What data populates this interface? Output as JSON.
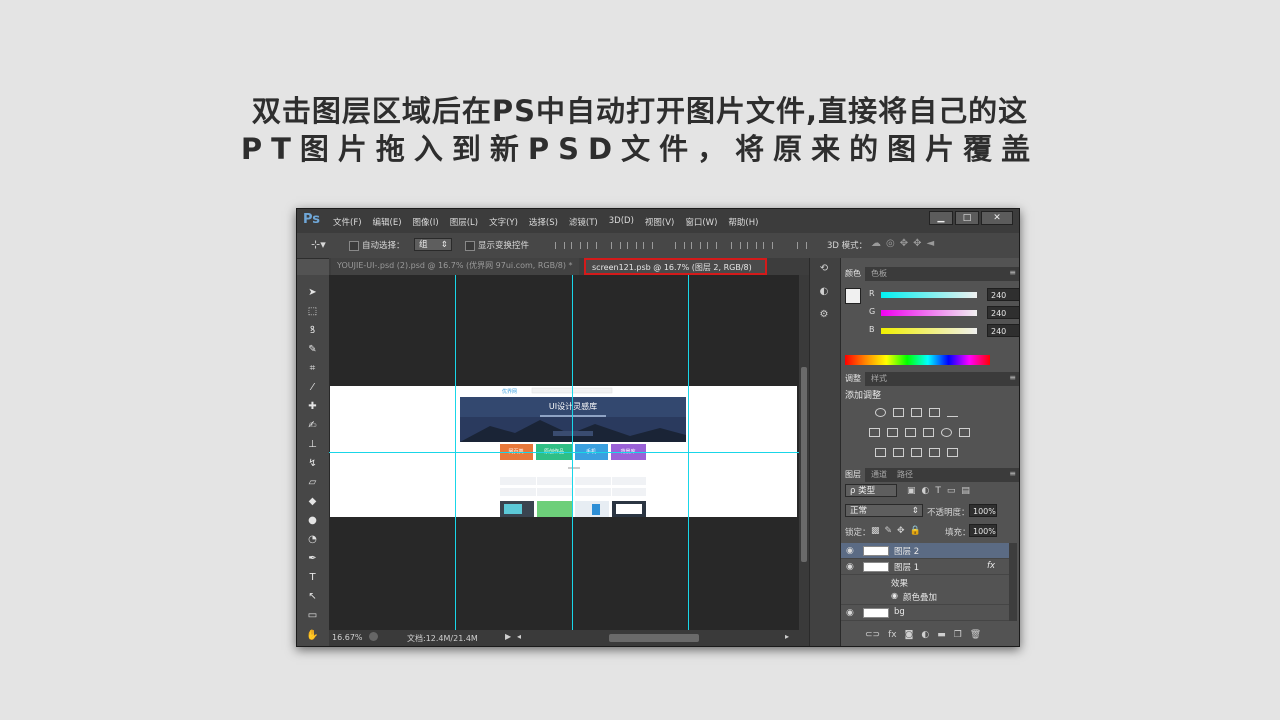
{
  "caption": {
    "line1": "双击图层区域后在PS中自动打开图片文件,直接将自己的这",
    "line2": "PT图片拖入到新PSD文件，将原来的图片覆盖"
  },
  "app": {
    "logo": "Ps",
    "menus": [
      "文件(F)",
      "编辑(E)",
      "图像(I)",
      "图层(L)",
      "文字(Y)",
      "选择(S)",
      "滤镜(T)",
      "3D(D)",
      "视图(V)",
      "窗口(W)",
      "帮助(H)"
    ],
    "window_buttons": [
      "▁",
      "□",
      "✕"
    ]
  },
  "options": {
    "auto_select_label": "自动选择：",
    "auto_select_value": "组",
    "show_transform_label": "显示变换控件",
    "mode_3d_label": "3D 模式："
  },
  "tabs": [
    {
      "label": "YOUJIE-UI-.psd (2).psd @ 16.7% (优界网 97ui.com, RGB/8) *",
      "close": "✕"
    },
    {
      "label": "screen121.psb @ 16.7% (图层 2, RGB/8)",
      "close": "✕"
    }
  ],
  "status": {
    "zoom": "16.67%",
    "doc_size": "文档:12.4M/21.4M"
  },
  "color_panel": {
    "tabs": [
      "颜色",
      "色板"
    ],
    "channels": [
      {
        "label": "R",
        "value": "240"
      },
      {
        "label": "G",
        "value": "240"
      },
      {
        "label": "B",
        "value": "240"
      }
    ]
  },
  "adjust_panel": {
    "tabs": [
      "调整",
      "样式"
    ],
    "title": "添加调整"
  },
  "layers_panel": {
    "tabs": [
      "图层",
      "通道",
      "路径"
    ],
    "filter_label": "ρ 类型",
    "blend_mode": "正常",
    "opacity_label": "不透明度：",
    "opacity_value": "100%",
    "lock_label": "锁定：",
    "fill_label": "填充：",
    "fill_value": "100%",
    "layers": [
      {
        "name": "图层 2"
      },
      {
        "name": "图层 1",
        "fx": "fx"
      },
      {
        "name": "效果"
      },
      {
        "name": "颜色叠加"
      },
      {
        "name": "bg"
      }
    ]
  },
  "document": {
    "brand": "优界网",
    "banner_title": "UI设计灵感库",
    "buttons": [
      "网页类",
      "原创作品",
      "手机",
      "背景库"
    ]
  },
  "colors": {
    "guide": "#19d6e8",
    "highlight": "#d41a1a",
    "banner": "#2a3a5e",
    "btn_orange": "#e8783a",
    "btn_green": "#2fbf86",
    "btn_blue": "#3aa0e0",
    "btn_purple": "#9a62d8"
  }
}
